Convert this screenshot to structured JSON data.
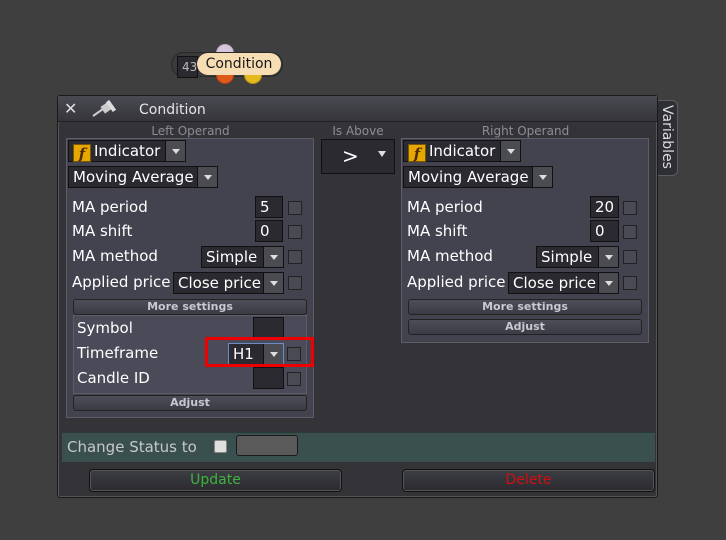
{
  "node": {
    "count": "43",
    "label": "Condition"
  },
  "side_tab": {
    "label": "Variables"
  },
  "window": {
    "title": "Condition"
  },
  "left": {
    "caption": "Left Operand",
    "type": "Indicator",
    "indicator": "Moving Average",
    "fields": {
      "ma_period": {
        "label": "MA period",
        "value": "5"
      },
      "ma_shift": {
        "label": "MA shift",
        "value": "0"
      },
      "ma_method": {
        "label": "MA method",
        "value": "Simple"
      },
      "applied_price": {
        "label": "Applied price",
        "value": "Close price"
      }
    },
    "more_settings": "More settings",
    "extra": {
      "symbol": {
        "label": "Symbol",
        "value": ""
      },
      "timeframe": {
        "label": "Timeframe",
        "value": "H1"
      },
      "candle_id": {
        "label": "Candle ID",
        "value": ""
      }
    },
    "adjust": "Adjust"
  },
  "operator": {
    "caption": "Is Above",
    "symbol": ">"
  },
  "right": {
    "caption": "Right Operand",
    "type": "Indicator",
    "indicator": "Moving Average",
    "fields": {
      "ma_period": {
        "label": "MA period",
        "value": "20"
      },
      "ma_shift": {
        "label": "MA shift",
        "value": "0"
      },
      "ma_method": {
        "label": "MA method",
        "value": "Simple"
      },
      "applied_price": {
        "label": "Applied price",
        "value": "Close price"
      }
    },
    "more_settings": "More settings",
    "adjust": "Adjust"
  },
  "status": {
    "label": "Change Status to"
  },
  "buttons": {
    "update": "Update",
    "delete": "Delete"
  },
  "colors": {
    "update": "#3cb43c",
    "delete": "#d01010",
    "highlight": "#e00000",
    "node_label_bg": "#f6ddb3"
  }
}
